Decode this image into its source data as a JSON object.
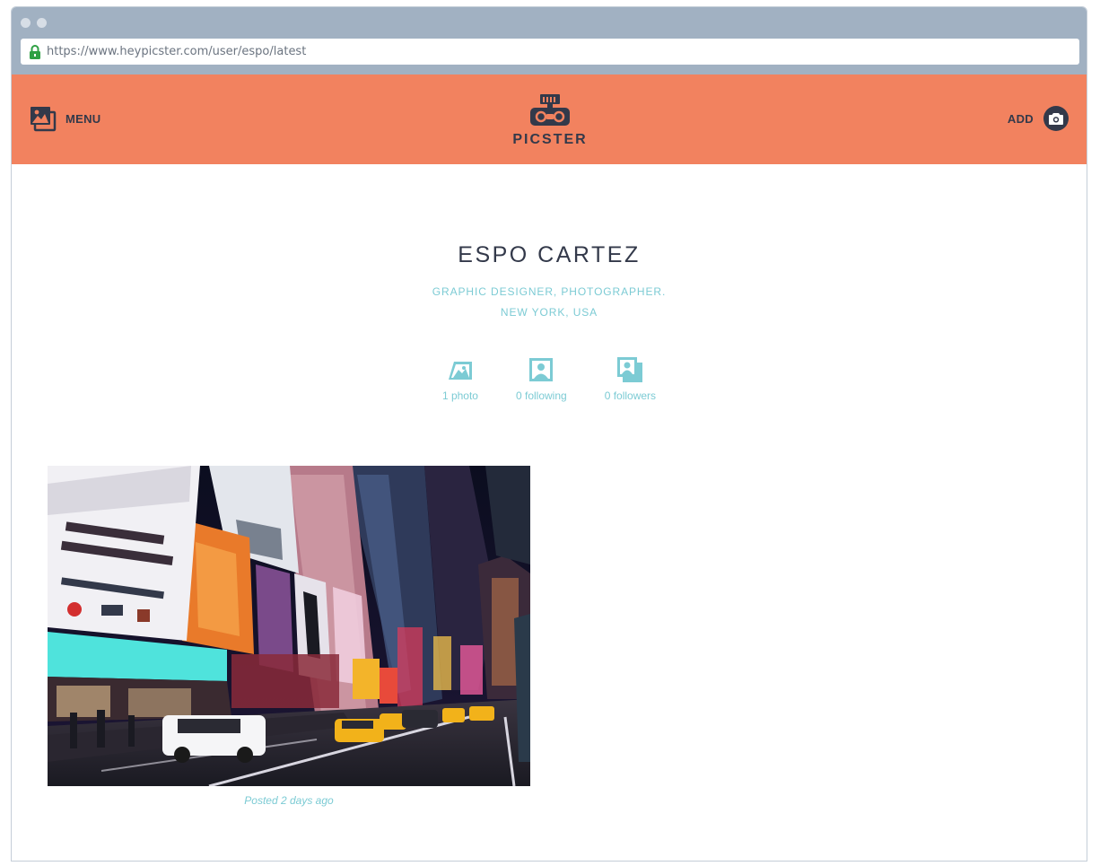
{
  "browser": {
    "url": "https://www.heypicster.com/user/espo/latest"
  },
  "nav": {
    "menu_label": "MENU",
    "menu_icon": "photos-icon",
    "brand": "PICSTER",
    "add_label": "ADD",
    "add_icon": "camera-icon"
  },
  "profile": {
    "name": "ESPO CARTEZ",
    "tagline": "GRAPHIC DESIGNER, PHOTOGRAPHER.",
    "location": "NEW YORK, USA"
  },
  "stats": [
    {
      "label": "1 photo",
      "icon": "photo-icon"
    },
    {
      "label": "0 following",
      "icon": "user-icon"
    },
    {
      "label": "0 followers",
      "icon": "users-icon"
    }
  ],
  "posts": [
    {
      "posted": "Posted 2 days ago"
    }
  ],
  "colors": {
    "nav_bg": "#f2825f",
    "accent": "#7ccbd4",
    "dark": "#33394a",
    "chrome": "#a1b1c2"
  }
}
